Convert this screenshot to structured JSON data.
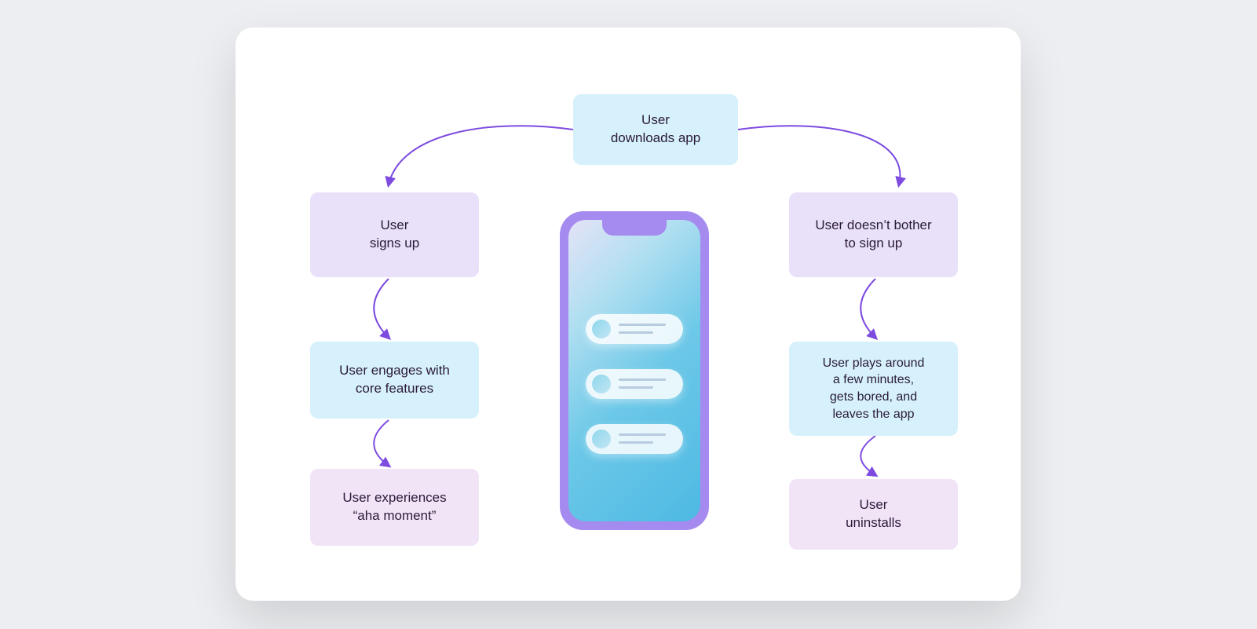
{
  "top": {
    "label": "User\ndownloads app"
  },
  "left": {
    "s1": "User\nsigns up",
    "s2": "User engages with\ncore features",
    "s3": "User experiences\n“aha moment”"
  },
  "right": {
    "s1": "User doesn’t bother\nto sign up",
    "s2": "User plays around\na few minutes,\ngets bored, and\nleaves the app",
    "s3": "User\nuninstalls"
  },
  "colors": {
    "arrow": "#7d4be0"
  }
}
